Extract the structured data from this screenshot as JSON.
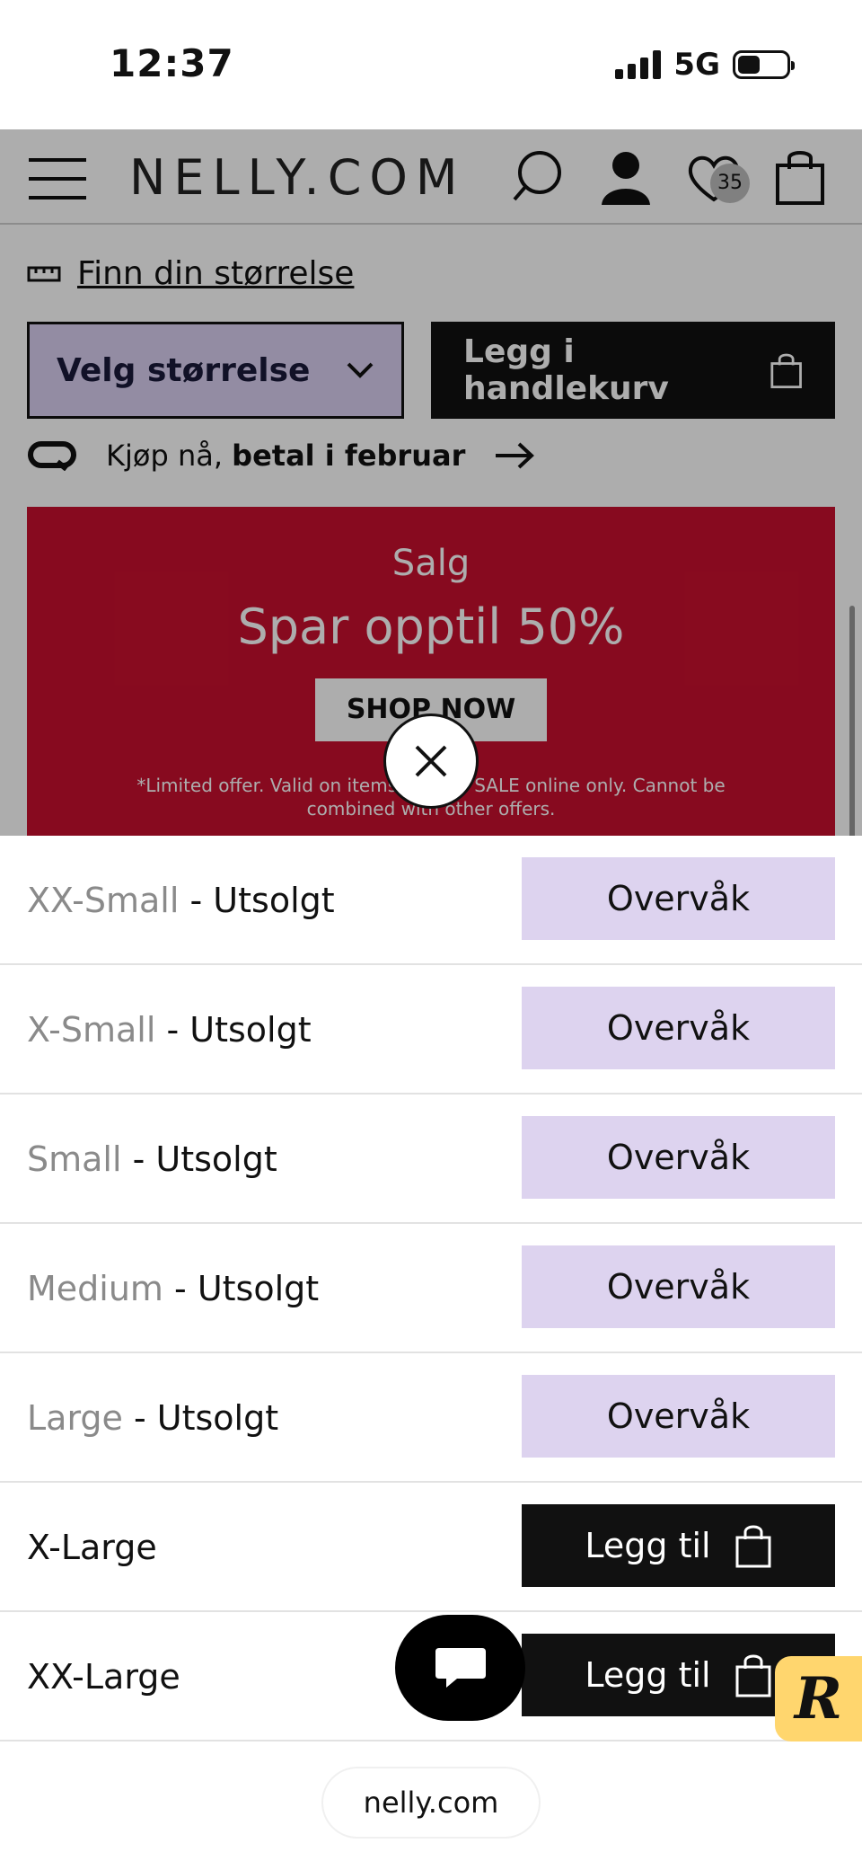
{
  "status_bar": {
    "time": "12:37",
    "network": "5G"
  },
  "header": {
    "logo": "NELLY.COM",
    "wishlist_count": "35"
  },
  "product": {
    "size_guide_label": "Finn din størrelse",
    "size_select_label": "Velg størrelse",
    "add_to_cart_label": "Legg i handlekurv",
    "klarna_prefix": "Kjøp nå, ",
    "klarna_bold": "betal i februar"
  },
  "banner": {
    "title": "Salg",
    "headline": "Spar opptil 50%",
    "button": "SHOP NOW",
    "note": "*Limited offer. Valid on items labeled SALE online only. Cannot be combined with other offers.",
    "color": "#c8102e"
  },
  "sizes": [
    {
      "size": "XX-Small",
      "status": " - Utsolgt",
      "action": "Overvåk",
      "available": false
    },
    {
      "size": "X-Small",
      "status": " - Utsolgt",
      "action": "Overvåk",
      "available": false
    },
    {
      "size": "Small",
      "status": " - Utsolgt",
      "action": "Overvåk",
      "available": false
    },
    {
      "size": "Medium",
      "status": " - Utsolgt",
      "action": "Overvåk",
      "available": false
    },
    {
      "size": "Large",
      "status": " - Utsolgt",
      "action": "Overvåk",
      "available": false
    },
    {
      "size": "X-Large",
      "status": "",
      "action": "Legg til",
      "available": true
    },
    {
      "size": "XX-Large",
      "status": "",
      "action": "Legg til",
      "available": true
    }
  ],
  "browser": {
    "url": "nelly.com"
  }
}
